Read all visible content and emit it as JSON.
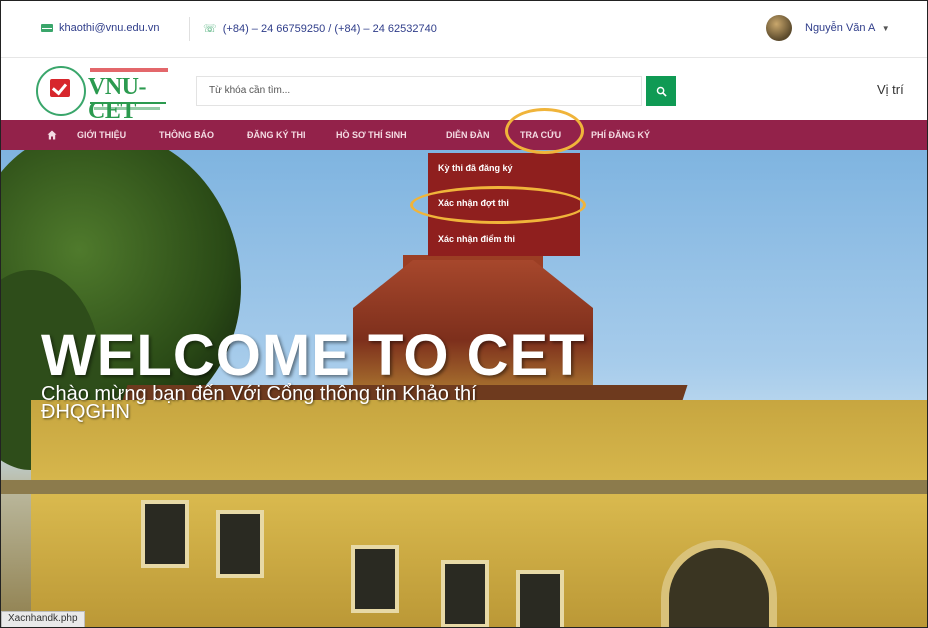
{
  "topbar": {
    "email": "khaothi@vnu.edu.vn",
    "phone": "(+84) – 24 66759250 / (+84) – 24 62532740",
    "user_name": "Nguyễn Văn A"
  },
  "logo": {
    "text": "VNU-CET"
  },
  "search": {
    "placeholder": "Từ khóa cần tìm..."
  },
  "location_label": "Vị trí",
  "nav": {
    "items": [
      {
        "label": "GIỚI THIỆU"
      },
      {
        "label": "THÔNG BÁO"
      },
      {
        "label": "ĐĂNG KÝ THI"
      },
      {
        "label": "HỒ SƠ THÍ SINH"
      },
      {
        "label": "DIỄN ĐÀN"
      },
      {
        "label": "TRA CỨU"
      },
      {
        "label": "PHÍ ĐĂNG KÝ"
      }
    ]
  },
  "dropdown": {
    "items": [
      {
        "label": "Kỳ thi đã đăng ký"
      },
      {
        "label": "Xác nhận đợt thi"
      },
      {
        "label": "Xác nhận điểm thi"
      }
    ]
  },
  "hero": {
    "title": "WELCOME TO CET",
    "subtitle": "Chào mừng bạn đến Với Cổng thông tin Khảo thí ĐHQGHN"
  },
  "status_url": "Xacnhandk.php",
  "colors": {
    "nav_bg": "#93224a",
    "dropdown_bg": "#8f1f1e",
    "accent_green": "#0f9a54",
    "highlight": "#f0b43a"
  }
}
